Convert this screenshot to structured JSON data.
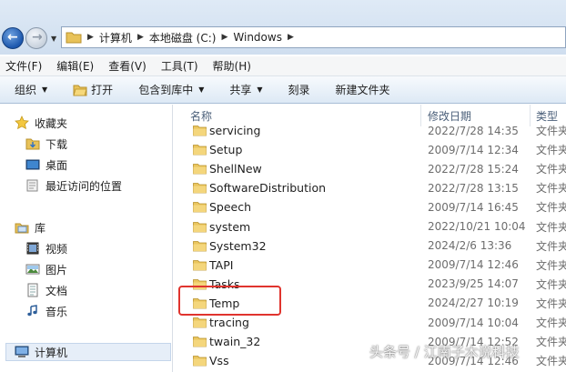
{
  "address": {
    "crumbs": [
      "计算机",
      "本地磁盘 (C:)",
      "Windows"
    ]
  },
  "menu": [
    "文件(F)",
    "编辑(E)",
    "查看(V)",
    "工具(T)",
    "帮助(H)"
  ],
  "toolbar": {
    "organize": "组织",
    "open": "打开",
    "include": "包含到库中",
    "share": "共享",
    "burn": "刻录",
    "new_folder": "新建文件夹"
  },
  "nav": {
    "favorites": "收藏夹",
    "downloads": "下载",
    "desktop": "桌面",
    "recent": "最近访问的位置",
    "libraries": "库",
    "videos": "视频",
    "pictures": "图片",
    "documents": "文档",
    "music": "音乐",
    "computer": "计算机"
  },
  "columns": {
    "name": "名称",
    "date": "修改日期",
    "type": "类型"
  },
  "files": [
    {
      "name": "servicing",
      "date": "2022/7/28 14:35",
      "type": "文件夹"
    },
    {
      "name": "Setup",
      "date": "2009/7/14 12:34",
      "type": "文件夹"
    },
    {
      "name": "ShellNew",
      "date": "2022/7/28 15:24",
      "type": "文件夹"
    },
    {
      "name": "SoftwareDistribution",
      "date": "2022/7/28 13:15",
      "type": "文件夹"
    },
    {
      "name": "Speech",
      "date": "2009/7/14 16:45",
      "type": "文件夹"
    },
    {
      "name": "system",
      "date": "2022/10/21 10:04",
      "type": "文件夹"
    },
    {
      "name": "System32",
      "date": "2024/2/6 13:36",
      "type": "文件夹"
    },
    {
      "name": "TAPI",
      "date": "2009/7/14 12:46",
      "type": "文件夹"
    },
    {
      "name": "Tasks",
      "date": "2023/9/25 14:07",
      "type": "文件夹"
    },
    {
      "name": "Temp",
      "date": "2024/2/27 10:19",
      "type": "文件夹"
    },
    {
      "name": "tracing",
      "date": "2009/7/14 10:04",
      "type": "文件夹"
    },
    {
      "name": "twain_32",
      "date": "2009/7/14 12:52",
      "type": "文件夹"
    },
    {
      "name": "Vss",
      "date": "2009/7/14 12:46",
      "type": "文件夹"
    }
  ],
  "watermark": "头条号 / 江南子木说科技"
}
